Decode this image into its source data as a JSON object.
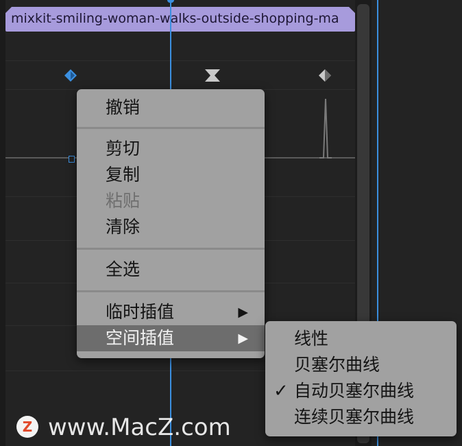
{
  "clip": {
    "title": "mixkit-smiling-woman-walks-outside-shopping-ma",
    "color": "#a79bdc"
  },
  "timeline": {
    "playhead_color": "#3b8fe0",
    "keyframe_icons": [
      "keyframe-diamond-icon",
      "keyframe-hourglass-icon",
      "keyframe-half-diamond-icon"
    ]
  },
  "context_menu": {
    "undo": "撤销",
    "cut": "剪切",
    "copy": "复制",
    "paste": "粘贴",
    "clear": "清除",
    "select_all": "全选",
    "temporal_interpolation": "临时插值",
    "spatial_interpolation": "空间插值",
    "submenu_arrow": "▶"
  },
  "submenu": {
    "items": [
      "线性",
      "贝塞尔曲线",
      "自动贝塞尔曲线",
      "连续贝塞尔曲线"
    ],
    "checked_index": 2,
    "check_glyph": "✓"
  },
  "watermark": {
    "logo_letter": "Z",
    "text": "www.MacZ.com"
  }
}
